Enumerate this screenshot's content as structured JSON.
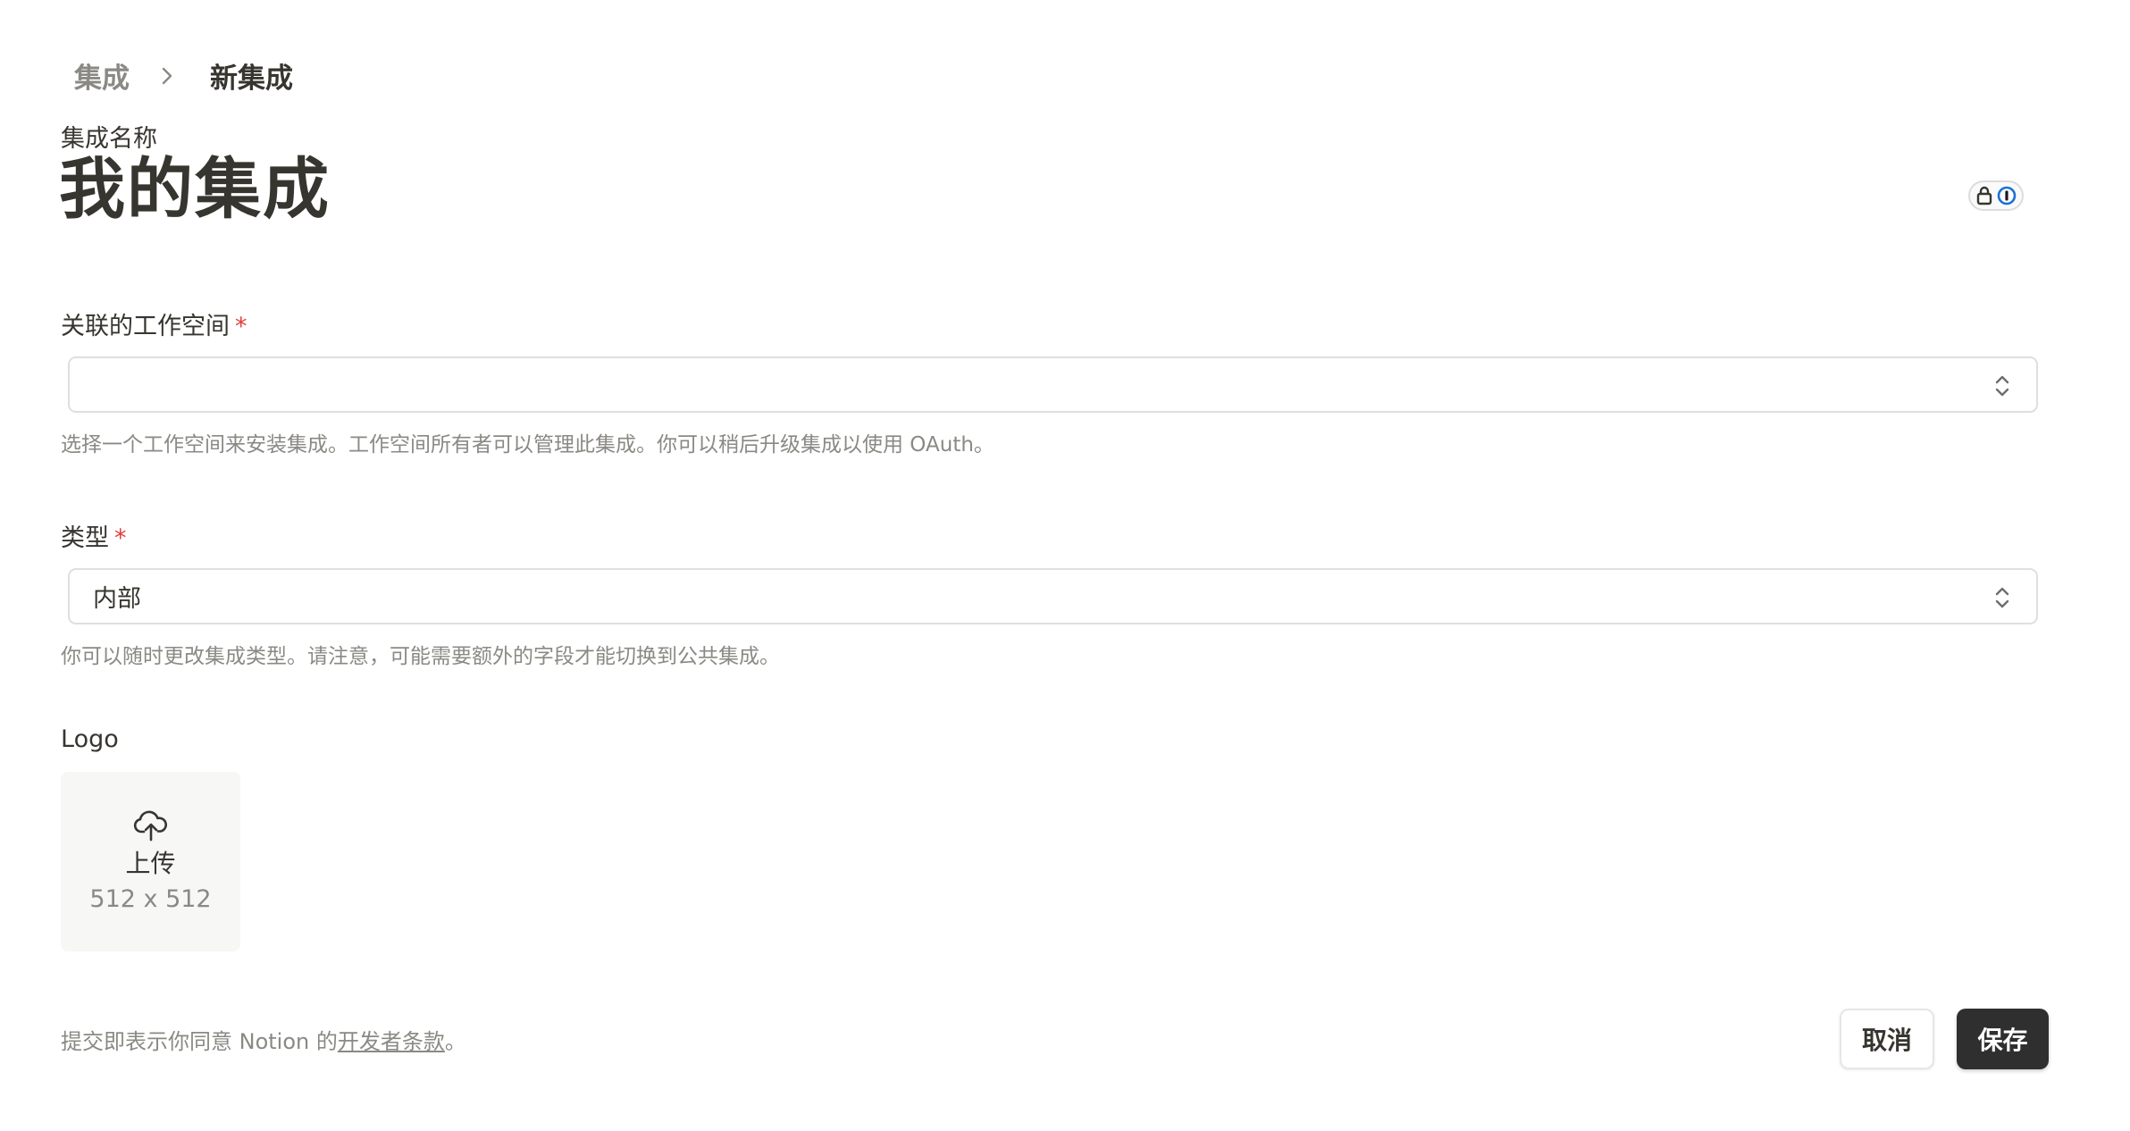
{
  "breadcrumb": {
    "root": "集成",
    "current": "新集成"
  },
  "integration_name": {
    "label": "集成名称",
    "value": "我的集成"
  },
  "workspace": {
    "label": "关联的工作空间",
    "required_mark": "*",
    "value": "",
    "hint": "选择一个工作空间来安装集成。工作空间所有者可以管理此集成。你可以稍后升级集成以使用 OAuth。"
  },
  "type": {
    "label": "类型",
    "required_mark": "*",
    "value": "内部",
    "hint": "你可以随时更改集成类型。请注意，可能需要额外的字段才能切换到公共集成。"
  },
  "logo": {
    "label": "Logo",
    "upload_label": "上传",
    "size": "512 x 512",
    "icon": "cloud-upload-icon"
  },
  "footer": {
    "terms_prefix": "提交即表示你同意 Notion 的",
    "terms_link": "开发者条款",
    "terms_suffix": "。",
    "cancel_label": "取消",
    "save_label": "保存"
  },
  "colors": {
    "text": "#37352f",
    "muted": "#8a8984",
    "required": "#e03e3e",
    "save_bg": "#2f2f2f",
    "password_manager_blue": "#1a6fd6"
  }
}
